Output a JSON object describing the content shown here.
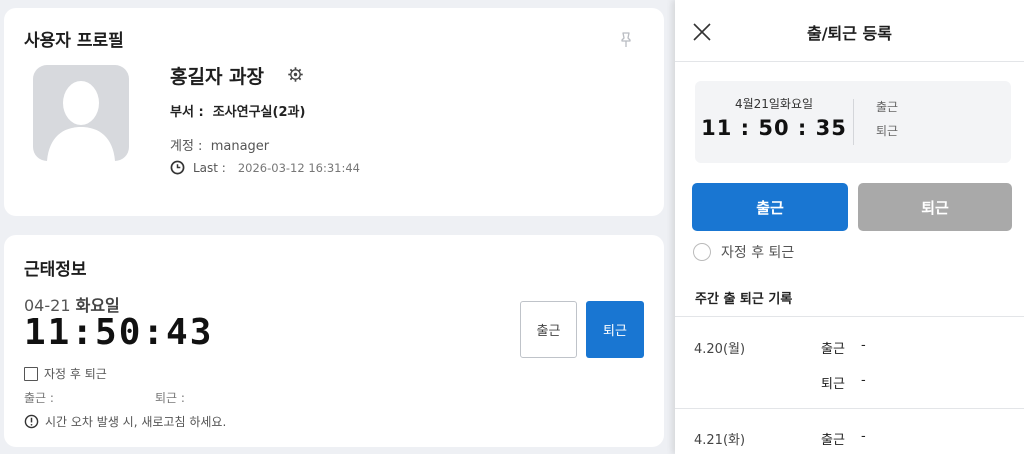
{
  "profile": {
    "title": "사용자 프로필",
    "name": "홍길자 과장",
    "dept_label": "부서 :",
    "dept_value": "조사연구실(2과)",
    "account_label": "계정 :",
    "account_value": "manager",
    "last_label": "Last :",
    "last_value": "2026-03-12 16:31:44"
  },
  "attendance": {
    "title": "근태정보",
    "date": "04-21",
    "weekday": "화요일",
    "clock": "11:50:43",
    "auto_checkout_label": "자정 후 퇴근",
    "in_label": "출근 :",
    "out_label": "퇴근 :",
    "warning": "시간 오차 발생 시, 새로고침 하세요.",
    "in_button": "출근",
    "out_button": "퇴근"
  },
  "panel": {
    "title": "출/퇴근 등록",
    "date": "4월21일화요일",
    "time": "11 : 50 : 35",
    "in_label": "출근",
    "out_label": "퇴근",
    "in_button": "출근",
    "out_button": "퇴근",
    "auto_checkout_label": "자정 후 퇴근",
    "weekly_title": "주간 출 퇴근 기록",
    "weekly": [
      {
        "day": "4.20(월)",
        "in_label": "출근",
        "in_value": "-",
        "out_label": "퇴근",
        "out_value": "-"
      },
      {
        "day": "4.21(화)",
        "in_label": "출근",
        "in_value": "-"
      }
    ]
  },
  "colors": {
    "accent": "#1976d2",
    "disabled": "#a9a9a9",
    "background": "#eef0f4"
  },
  "icons": [
    "pin-icon",
    "gear-icon",
    "clock-icon",
    "warning-icon",
    "close-icon",
    "avatar-placeholder-icon"
  ]
}
